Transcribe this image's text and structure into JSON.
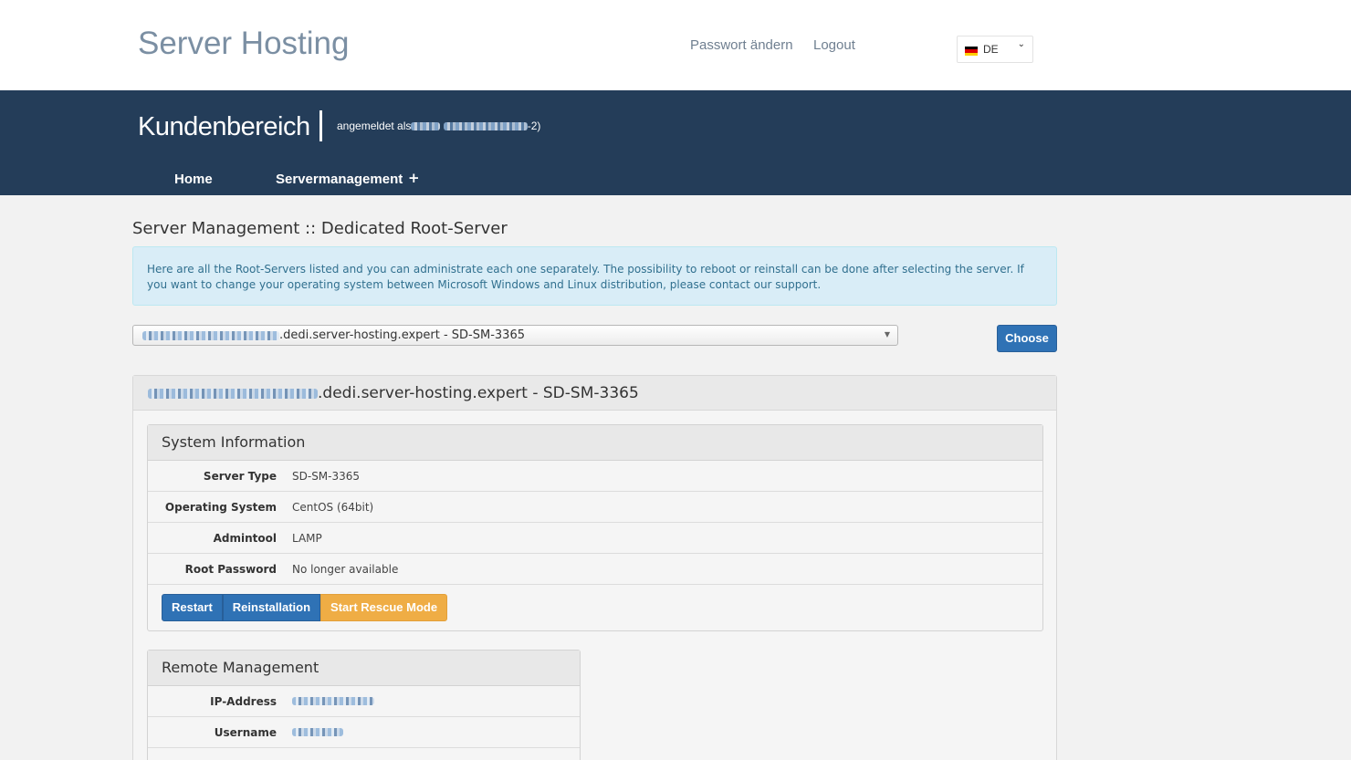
{
  "header": {
    "brand": "Server Hosting",
    "links": {
      "change_password": "Passwort ändern",
      "logout": "Logout"
    },
    "language": {
      "selected": "DE",
      "flag_colors": [
        "#000000",
        "#dd0000",
        "#ffce00"
      ]
    }
  },
  "portal": {
    "title": "Kundenbereich",
    "logged_in_prefix": "angemeldet als",
    "logged_in_suffix": "-2)",
    "nav": {
      "home": "Home",
      "server_management": "Servermanagement",
      "expand": "+"
    }
  },
  "main": {
    "title": "Server Management :: Dedicated Root-Server",
    "info": "Here are all the Root-Servers listed and you can administrate each one separately. The possibility to reboot or reinstall can be done after selecting the server. If you want to change your operating system between Microsoft Windows and Linux distribution, please contact our support.",
    "server_select": {
      "value_suffix": ".dedi.server-hosting.expert - SD-SM-3365"
    },
    "choose_label": "Choose",
    "server_panel_title_suffix": ".dedi.server-hosting.expert - SD-SM-3365"
  },
  "system_info": {
    "title": "System Information",
    "rows": [
      {
        "label": "Server Type",
        "value": "SD-SM-3365"
      },
      {
        "label": "Operating System",
        "value": "CentOS (64bit)"
      },
      {
        "label": "Admintool",
        "value": "LAMP"
      },
      {
        "label": "Root Password",
        "value": "No longer available"
      }
    ],
    "buttons": {
      "restart": "Restart",
      "reinstall": "Reinstallation",
      "rescue": "Start Rescue Mode"
    }
  },
  "remote_management": {
    "title": "Remote Management",
    "rows": [
      {
        "label": "IP-Address"
      },
      {
        "label": "Username"
      }
    ]
  },
  "colors": {
    "header_bg": "#243d59",
    "primary_button": "#2f72b5",
    "warning_button": "#efad45",
    "info_bg": "#d9edf7"
  }
}
